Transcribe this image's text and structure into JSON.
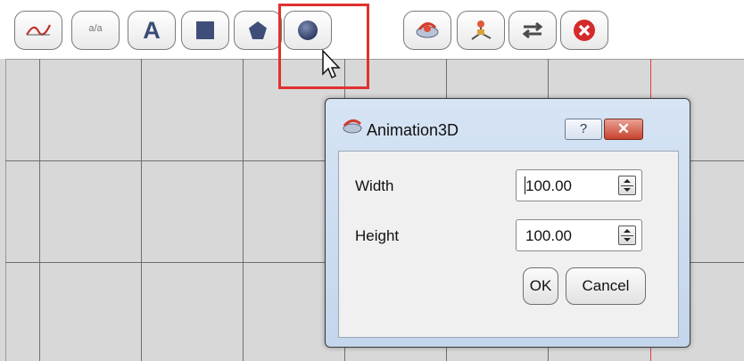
{
  "toolbar": {
    "tools": [
      {
        "name": "function-graph-tool",
        "icon": "graph-curve-icon"
      },
      {
        "name": "fraction-tool",
        "icon": "fraction-icon",
        "label": "a/a"
      },
      {
        "name": "text-tool",
        "icon": "text-a-icon",
        "label": "A"
      },
      {
        "name": "rectangle-tool",
        "icon": "square-icon"
      },
      {
        "name": "pentagon-tool",
        "icon": "pentagon-icon"
      },
      {
        "name": "sphere-tool",
        "icon": "sphere-icon"
      },
      {
        "name": "animation3d-tool",
        "icon": "animation3d-icon"
      },
      {
        "name": "axes3d-tool",
        "icon": "axes3d-icon"
      },
      {
        "name": "swap-tool",
        "icon": "swap-arrows-icon"
      },
      {
        "name": "delete-tool",
        "icon": "close-circle-icon"
      }
    ]
  },
  "dialog": {
    "title": "Animation3D",
    "help_label": "?",
    "close_label": "✕",
    "width_label": "Width",
    "width_value": "100.00",
    "height_label": "Height",
    "height_value": "100.00",
    "ok_label": "OK",
    "cancel_label": "Cancel"
  },
  "colors": {
    "highlight": "#e23030",
    "grid_line": "#6f6f6f",
    "canvas": "#d8d8d8",
    "axis": "#e04040"
  }
}
